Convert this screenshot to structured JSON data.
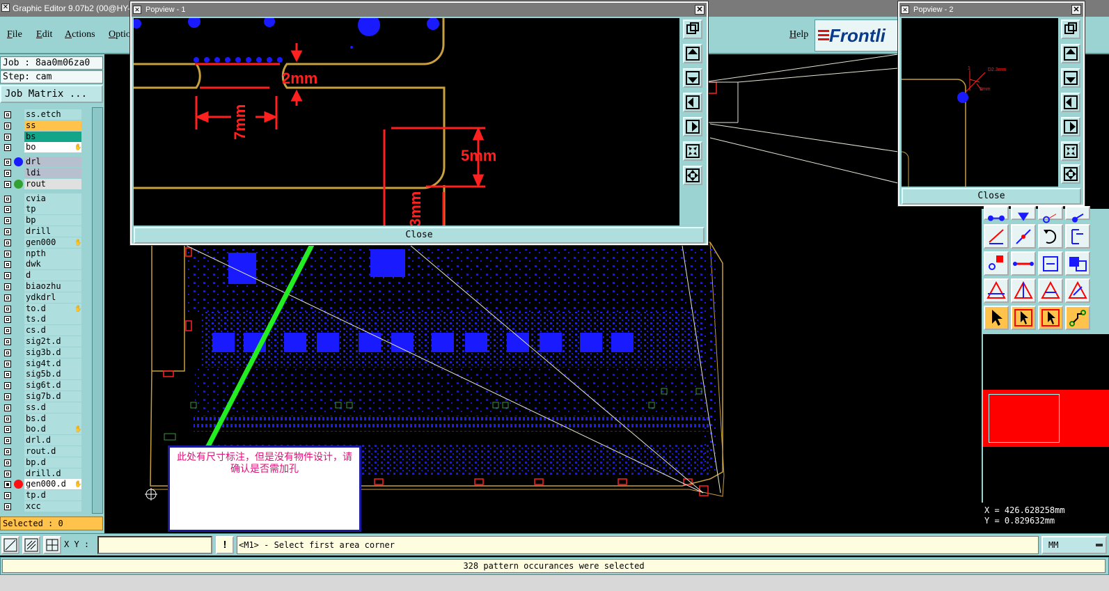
{
  "app": {
    "title": "Graphic Editor 9.07b2 (00@HY-",
    "menus": [
      "File",
      "Edit",
      "Actions",
      "Optio"
    ],
    "help": "Help",
    "logo_text": "Frontli"
  },
  "job": {
    "job_label": "Job : 8aa0m06za0",
    "step_label": "Step: cam",
    "matrix_button": "Job Matrix ...",
    "selected": "Selected : 0"
  },
  "layers": [
    {
      "name": "ss.etch",
      "bg": "#aedede",
      "dot": ""
    },
    {
      "name": "ss",
      "bg": "#ffc24a",
      "dot": ""
    },
    {
      "name": "bs",
      "bg": "#13a58a",
      "dot": ""
    },
    {
      "name": "bo",
      "bg": "#ffffff",
      "dot": "",
      "icon": "hand-icon"
    },
    {
      "name": "drl",
      "bg": "#b8c0d0",
      "dot": "#1a1aff",
      "sep": true
    },
    {
      "name": "ldi",
      "bg": "#b8c0d0",
      "dot": ""
    },
    {
      "name": "rout",
      "bg": "#e0e0e0",
      "dot": "#33a033"
    },
    {
      "name": "cvia",
      "bg": "#aedede",
      "dot": "",
      "sep": true
    },
    {
      "name": "tp",
      "bg": "#aedede",
      "dot": ""
    },
    {
      "name": "bp",
      "bg": "#aedede",
      "dot": ""
    },
    {
      "name": "drill",
      "bg": "#aedede",
      "dot": ""
    },
    {
      "name": "gen000",
      "bg": "#aedede",
      "dot": "",
      "icon": "hand-icon"
    },
    {
      "name": "npth",
      "bg": "#aedede",
      "dot": ""
    },
    {
      "name": "dwk",
      "bg": "#aedede",
      "dot": ""
    },
    {
      "name": "d",
      "bg": "#aedede",
      "dot": ""
    },
    {
      "name": "biaozhu",
      "bg": "#aedede",
      "dot": ""
    },
    {
      "name": "ydkdrl",
      "bg": "#aedede",
      "dot": ""
    },
    {
      "name": "to.d",
      "bg": "#aedede",
      "dot": "",
      "icon": "hand-icon"
    },
    {
      "name": "ts.d",
      "bg": "#aedede",
      "dot": ""
    },
    {
      "name": "cs.d",
      "bg": "#aedede",
      "dot": ""
    },
    {
      "name": "sig2t.d",
      "bg": "#aedede",
      "dot": ""
    },
    {
      "name": "sig3b.d",
      "bg": "#aedede",
      "dot": ""
    },
    {
      "name": "sig4t.d",
      "bg": "#aedede",
      "dot": ""
    },
    {
      "name": "sig5b.d",
      "bg": "#aedede",
      "dot": ""
    },
    {
      "name": "sig6t.d",
      "bg": "#aedede",
      "dot": ""
    },
    {
      "name": "sig7b.d",
      "bg": "#aedede",
      "dot": ""
    },
    {
      "name": "ss.d",
      "bg": "#aedede",
      "dot": ""
    },
    {
      "name": "bs.d",
      "bg": "#aedede",
      "dot": ""
    },
    {
      "name": "bo.d",
      "bg": "#aedede",
      "dot": "",
      "icon": "hand-icon"
    },
    {
      "name": "drl.d",
      "bg": "#aedede",
      "dot": ""
    },
    {
      "name": "rout.d",
      "bg": "#aedede",
      "dot": ""
    },
    {
      "name": "bp.d",
      "bg": "#aedede",
      "dot": ""
    },
    {
      "name": "drill.d",
      "bg": "#aedede",
      "dot": ""
    },
    {
      "name": "gen000.d",
      "bg": "#ffffff",
      "dot": "#ff1010",
      "icon": "hand-icon",
      "checked": true
    },
    {
      "name": "tp.d",
      "bg": "#aedede",
      "dot": ""
    },
    {
      "name": "xcc",
      "bg": "#aedede",
      "dot": ""
    }
  ],
  "popview1": {
    "title": "Popview - 1",
    "close": "Close",
    "dims": [
      "2mm",
      "7mm",
      "5mm",
      "3mm"
    ]
  },
  "popview2": {
    "title": "Popview - 2",
    "close": "Close",
    "dims": [
      "D2.3mm",
      "1",
      "3mm"
    ]
  },
  "coords": {
    "x": "X = 426.628258mm",
    "y": "Y = 0.829632mm"
  },
  "bottom": {
    "xy_label": "X Y :",
    "bang": "!",
    "prompt": "<M1> - Select first area corner",
    "units": "MM",
    "status": "328 pattern occurances were selected"
  },
  "annotation": {
    "text": "此处有尺寸标注，但是没有物件设计，请确认是否需加孔"
  },
  "colors": {
    "panel": "#9bd3d3",
    "board_outline": "#c8a040",
    "dimension": "#ff2020",
    "copper": "#1a1aff",
    "arrow": "#22ee22"
  }
}
